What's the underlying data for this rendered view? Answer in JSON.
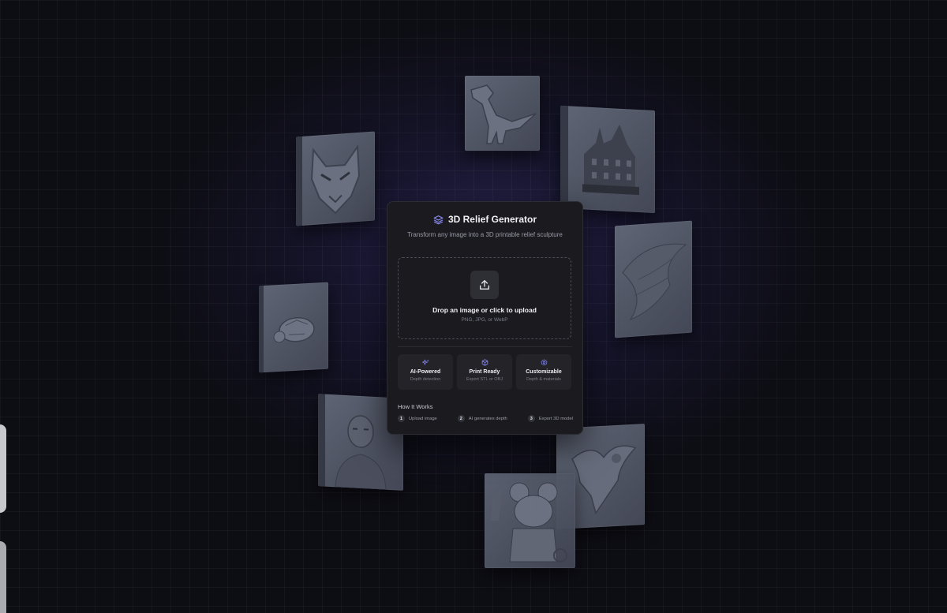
{
  "app": {
    "title": "3D Relief Generator",
    "subtitle": "Transform any image into a 3D printable relief sculpture"
  },
  "upload": {
    "label": "Drop an image or click to upload",
    "formats": "PNG, JPG, or WebP",
    "icon": "upload-icon"
  },
  "features": [
    {
      "title": "AI-Powered",
      "desc": "Depth detection",
      "icon": "sparkles-icon"
    },
    {
      "title": "Print Ready",
      "desc": "Export STL or OBJ",
      "icon": "cube-icon"
    },
    {
      "title": "Customizable",
      "desc": "Depth & materials",
      "icon": "settings-icon"
    }
  ],
  "how_it_works": {
    "title": "How It Works",
    "steps": [
      {
        "num": "1",
        "label": "Upload image"
      },
      {
        "num": "2",
        "label": "AI generates depth"
      },
      {
        "num": "3",
        "label": "Export 3D model"
      }
    ]
  },
  "gallery": [
    {
      "subject": "wolf"
    },
    {
      "subject": "dinosaur"
    },
    {
      "subject": "mansion"
    },
    {
      "subject": "turtle"
    },
    {
      "subject": "portrait"
    },
    {
      "subject": "swan"
    },
    {
      "subject": "mouse"
    },
    {
      "subject": "dragon"
    }
  ],
  "colors": {
    "background": "#0d0d14",
    "card": "#1a1a1f",
    "accent": "#8b8cf5",
    "tile": "#5a5f6e"
  }
}
